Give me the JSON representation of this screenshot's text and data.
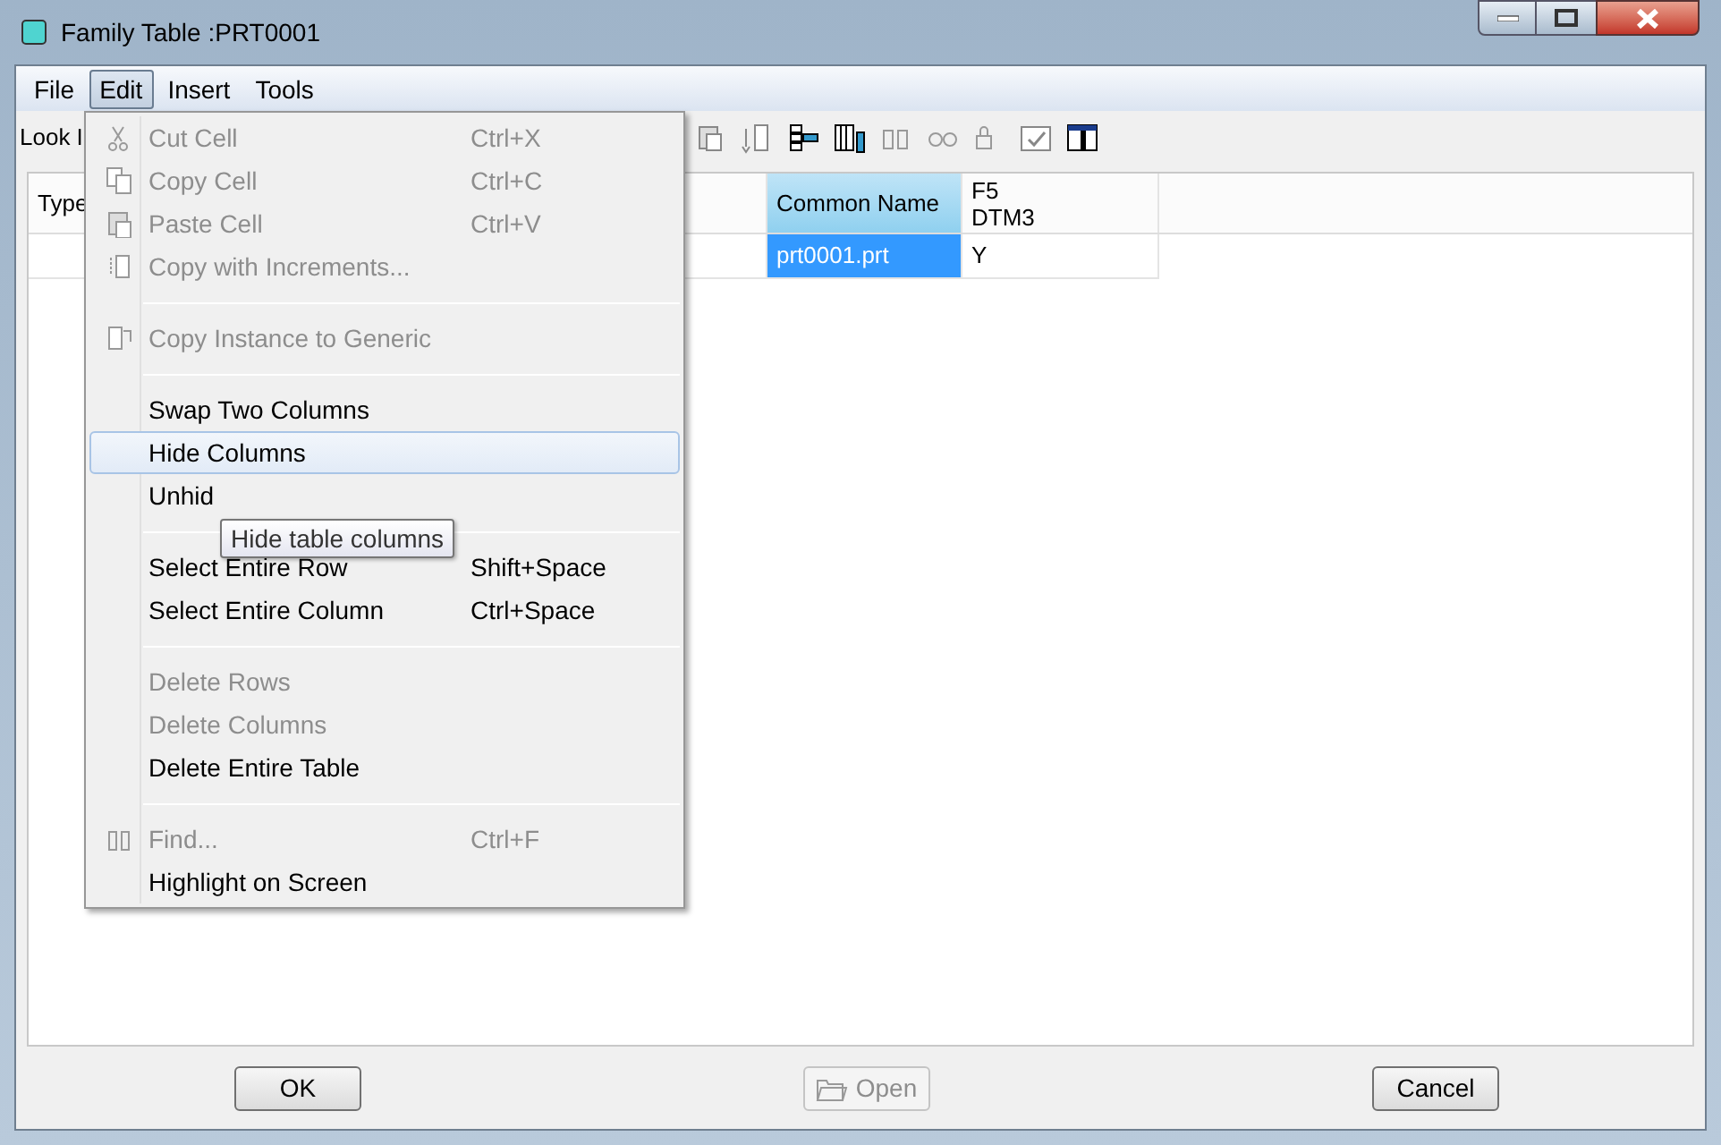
{
  "window": {
    "title": "Family Table :PRT0001"
  },
  "menubar": [
    {
      "label": "File",
      "selected": false
    },
    {
      "label": "Edit",
      "selected": true
    },
    {
      "label": "Insert",
      "selected": false
    },
    {
      "label": "Tools",
      "selected": false
    }
  ],
  "toolbar": {
    "label": "Look I"
  },
  "table": {
    "columns": [
      {
        "label": "Type",
        "selected": false
      },
      {
        "label": "Common Name",
        "selected": true
      },
      {
        "label": "F5\nDTM3",
        "selected": false
      }
    ],
    "rows": [
      {
        "cells": [
          {
            "text": "",
            "selected": false
          },
          {
            "text": "prt0001.prt",
            "selected": true
          },
          {
            "text": "Y",
            "selected": false
          }
        ]
      }
    ]
  },
  "menu": [
    {
      "kind": "item",
      "label": "Cut Cell",
      "shortcut": "Ctrl+X",
      "disabled": true,
      "selected": false
    },
    {
      "kind": "item",
      "label": "Copy Cell",
      "shortcut": "Ctrl+C",
      "disabled": true,
      "selected": false
    },
    {
      "kind": "item",
      "label": "Paste Cell",
      "shortcut": "Ctrl+V",
      "disabled": true,
      "selected": false
    },
    {
      "kind": "item",
      "label": "Copy with Increments...",
      "disabled": true,
      "selected": false
    },
    {
      "kind": "separator"
    },
    {
      "kind": "item",
      "label": "Copy Instance to Generic",
      "disabled": true,
      "selected": false
    },
    {
      "kind": "separator"
    },
    {
      "kind": "item",
      "label": "Swap Two Columns",
      "disabled": false,
      "selected": false
    },
    {
      "kind": "item",
      "label": "Hide Columns",
      "disabled": false,
      "selected": true
    },
    {
      "kind": "item",
      "label": "Unhid",
      "disabled": false,
      "selected": false
    },
    {
      "kind": "separator"
    },
    {
      "kind": "item",
      "label": "Select Entire Row",
      "shortcut": "Shift+Space",
      "disabled": false,
      "selected": false
    },
    {
      "kind": "item",
      "label": "Select Entire Column",
      "shortcut": "Ctrl+Space",
      "disabled": false,
      "selected": false
    },
    {
      "kind": "separator"
    },
    {
      "kind": "item",
      "label": "Delete Rows",
      "disabled": true,
      "selected": false
    },
    {
      "kind": "item",
      "label": "Delete Columns",
      "disabled": true,
      "selected": false
    },
    {
      "kind": "item",
      "label": "Delete Entire Table",
      "disabled": false,
      "selected": false
    },
    {
      "kind": "separator"
    },
    {
      "kind": "item",
      "label": "Find...",
      "shortcut": "Ctrl+F",
      "disabled": true,
      "selected": false
    },
    {
      "kind": "item",
      "label": "Highlight on Screen",
      "disabled": false,
      "selected": false
    }
  ],
  "tooltip": "Hide table columns",
  "buttons": [
    {
      "label": "OK",
      "disabled": false
    },
    {
      "label": "Open",
      "disabled": true
    },
    {
      "label": "Cancel",
      "disabled": false
    }
  ]
}
